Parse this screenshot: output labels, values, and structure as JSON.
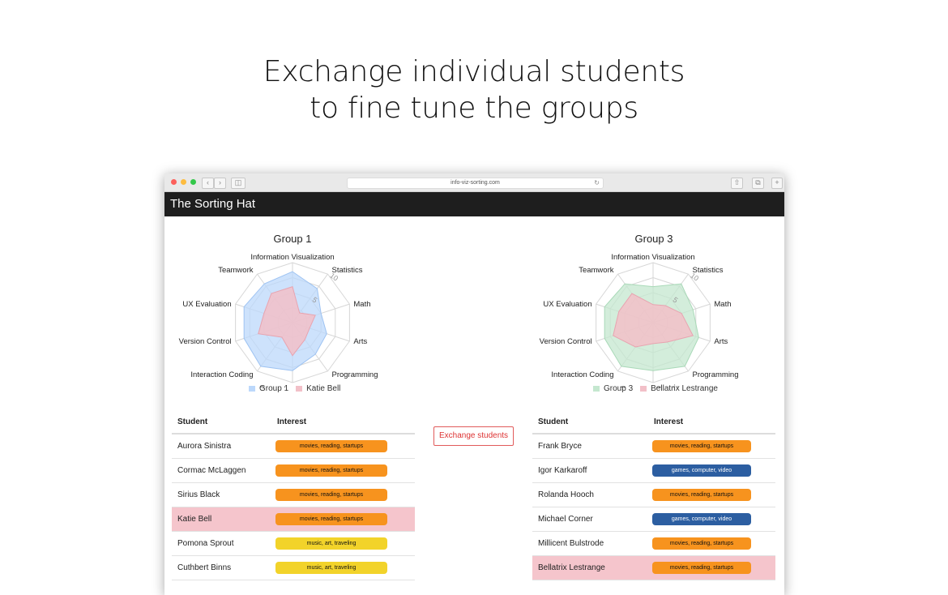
{
  "headline": {
    "line1": "Exchange individual students",
    "line2": "to fine tune the groups"
  },
  "browser": {
    "url": "info-viz-sorting.com"
  },
  "app": {
    "title": "The Sorting Hat"
  },
  "exchange_label": "Exchange students",
  "radar_axes": [
    "Information Visualization",
    "Statistics",
    "Math",
    "Arts",
    "Programming",
    "Computer Graphics",
    "Interaction Coding",
    "Version Control",
    "UX Evaluation",
    "Teamwork"
  ],
  "scale_labels": [
    "5",
    "10"
  ],
  "colors": {
    "group1": "#bcd8fb",
    "group3": "#c4e7cf",
    "student": "#f2c0c8",
    "movies": "#f7931e",
    "music": "#f2d32a",
    "games": "#2c5ea1",
    "highlight": "#f5c5cc"
  },
  "left": {
    "title": "Group 1",
    "legend_group": "Group 1",
    "legend_student": "Katie Bell",
    "group_values": [
      8.5,
      7,
      5,
      6,
      6.5,
      8,
      9,
      8.5,
      8.5,
      8
    ],
    "student_values": [
      6,
      2,
      4,
      3,
      3.5,
      5.5,
      3,
      6,
      5,
      6
    ],
    "table": {
      "headers": [
        "Student",
        "Interest"
      ],
      "rows": [
        {
          "name": "Aurora Sinistra",
          "interest": "movies, reading, startups",
          "kind": "movies"
        },
        {
          "name": "Cormac McLaggen",
          "interest": "movies, reading, startups",
          "kind": "movies"
        },
        {
          "name": "Sirius Black",
          "interest": "movies, reading, startups",
          "kind": "movies"
        },
        {
          "name": "Katie Bell",
          "interest": "movies, reading, startups",
          "kind": "movies",
          "highlight": true
        },
        {
          "name": "Pomona Sprout",
          "interest": "music, art, traveling",
          "kind": "music"
        },
        {
          "name": "Cuthbert Binns",
          "interest": "music, art, traveling",
          "kind": "music"
        }
      ]
    }
  },
  "right": {
    "title": "Group 3",
    "legend_group": "Group 3",
    "legend_student": "Bellatrix Lestrange",
    "group_values": [
      6,
      8,
      7,
      8,
      9,
      8,
      9,
      8.5,
      8.5,
      8
    ],
    "student_values": [
      3,
      3.5,
      5,
      7,
      4,
      3.5,
      5,
      7,
      6,
      6
    ],
    "table": {
      "headers": [
        "Student",
        "Interest"
      ],
      "rows": [
        {
          "name": "Frank Bryce",
          "interest": "movies, reading, startups",
          "kind": "movies"
        },
        {
          "name": "Igor Karkaroff",
          "interest": "games, computer, video",
          "kind": "games"
        },
        {
          "name": "Rolanda Hooch",
          "interest": "movies, reading, startups",
          "kind": "movies"
        },
        {
          "name": "Michael Corner",
          "interest": "games, computer, video",
          "kind": "games"
        },
        {
          "name": "Millicent Bulstrode",
          "interest": "movies, reading, startups",
          "kind": "movies"
        },
        {
          "name": "Bellatrix Lestrange",
          "interest": "movies, reading, startups",
          "kind": "movies",
          "highlight": true
        }
      ]
    }
  }
}
